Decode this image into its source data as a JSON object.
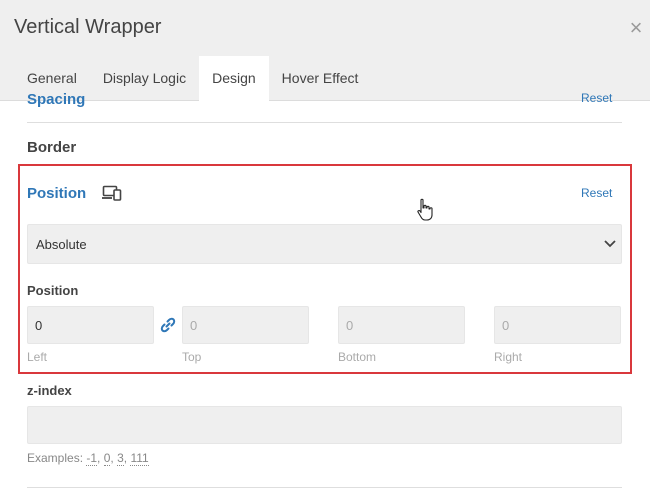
{
  "window": {
    "title": "Vertical Wrapper",
    "close_symbol": "×"
  },
  "tabs": [
    {
      "label": "General",
      "active": false
    },
    {
      "label": "Display Logic",
      "active": false
    },
    {
      "label": "Design",
      "active": true
    },
    {
      "label": "Hover Effect",
      "active": false
    }
  ],
  "sections": {
    "spacing": {
      "title": "Spacing",
      "reset_label": "Reset"
    },
    "border": {
      "title": "Border"
    },
    "position": {
      "title": "Position",
      "reset_label": "Reset",
      "select_value": "Absolute",
      "offsets_label": "Position",
      "offsets": {
        "left": {
          "label": "Left",
          "value": "0"
        },
        "top": {
          "label": "Top",
          "placeholder": "0"
        },
        "bottom": {
          "label": "Bottom",
          "placeholder": "0"
        },
        "right": {
          "label": "Right",
          "placeholder": "0"
        }
      }
    },
    "z_index": {
      "title": "z-index",
      "value": "",
      "examples_prefix": "Examples:",
      "examples": [
        "-1",
        "0",
        "3",
        "111"
      ]
    }
  },
  "colors": {
    "accent": "#2f77b7",
    "highlight_border": "#d9383c",
    "header_bg": "#efefef",
    "input_bg": "#efefef"
  }
}
